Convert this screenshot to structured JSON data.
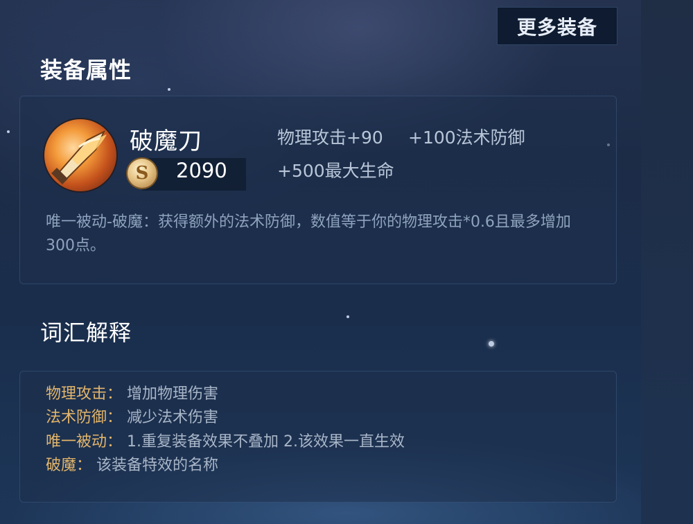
{
  "header": {
    "more_button_label": "更多装备"
  },
  "attributes_section": {
    "title": "装备属性",
    "item": {
      "name": "破魔刀",
      "icon": "demon-breaker-blade-icon",
      "currency_icon": "gold-coin-icon",
      "price": "2090",
      "stats": [
        "物理攻击+90",
        "+100法术防御",
        "+500最大生命"
      ],
      "passive": "唯一被动-破魔：获得额外的法术防御，数值等于你的物理攻击*0.6且最多增加300点。"
    }
  },
  "glossary_section": {
    "title": "词汇解释",
    "entries": [
      {
        "term": "物理攻击：",
        "definition": "增加物理伤害"
      },
      {
        "term": "法术防御：",
        "definition": "减少法术伤害"
      },
      {
        "term": "唯一被动：",
        "definition": "1.重复装备效果不叠加 2.该效果一直生效"
      },
      {
        "term": "破魔：",
        "definition": "该装备特效的名称"
      }
    ]
  },
  "colors": {
    "background": "#1c2c47",
    "glossary_term": "#e3b56b",
    "stat_text": "#b9c6d8"
  }
}
